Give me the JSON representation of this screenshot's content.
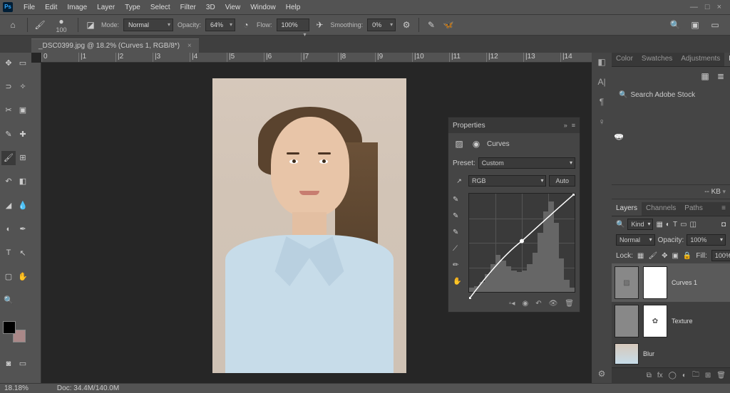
{
  "menu": [
    "File",
    "Edit",
    "Image",
    "Layer",
    "Type",
    "Select",
    "Filter",
    "3D",
    "View",
    "Window",
    "Help"
  ],
  "win_ctrl": {
    "min": "—",
    "max": "□",
    "close": "×"
  },
  "options": {
    "brush_size": "100",
    "mode_label": "Mode:",
    "mode_value": "Normal",
    "opacity_label": "Opacity:",
    "opacity_value": "64%",
    "flow_label": "Flow:",
    "flow_value": "100%",
    "smoothing_label": "Smoothing:",
    "smoothing_value": "0%"
  },
  "tab": {
    "title": "_DSC0399.jpg @ 18.2% (Curves 1, RGB/8*)",
    "close": "×"
  },
  "ruler_marks": [
    "0",
    "|1",
    "|2",
    "|3",
    "|4",
    "|5",
    "|6",
    "|7",
    "|8",
    "|9",
    "|10",
    "|11",
    "|12",
    "|13",
    "|14"
  ],
  "properties": {
    "title": "Properties",
    "type": "Curves",
    "preset_label": "Preset:",
    "preset_value": "Custom",
    "channel": "RGB",
    "auto": "Auto"
  },
  "libraries": {
    "tabs": [
      "Color",
      "Swatches",
      "Adjustments",
      "Libraries"
    ],
    "active": 3,
    "search_placeholder": "Search Adobe Stock",
    "kb": "-- KB"
  },
  "layers_panel": {
    "tabs": [
      "Layers",
      "Channels",
      "Paths"
    ],
    "active": 0,
    "kind": "Kind",
    "blend": "Normal",
    "opacity_label": "Opacity:",
    "opacity": "100%",
    "fill_label": "Fill:",
    "fill": "100%",
    "lock_label": "Lock:",
    "layers": [
      {
        "name": "Curves 1",
        "type": "adj",
        "selected": true
      },
      {
        "name": "Texture",
        "type": "white",
        "selected": false
      },
      {
        "name": "Blur",
        "type": "pic",
        "selected": false
      }
    ]
  },
  "status": {
    "zoom": "18.18%",
    "doc": "Doc: 34.4M/140.0M"
  },
  "dock_icons": [
    "◧",
    "A|",
    "¶",
    "♀",
    "⚙"
  ]
}
